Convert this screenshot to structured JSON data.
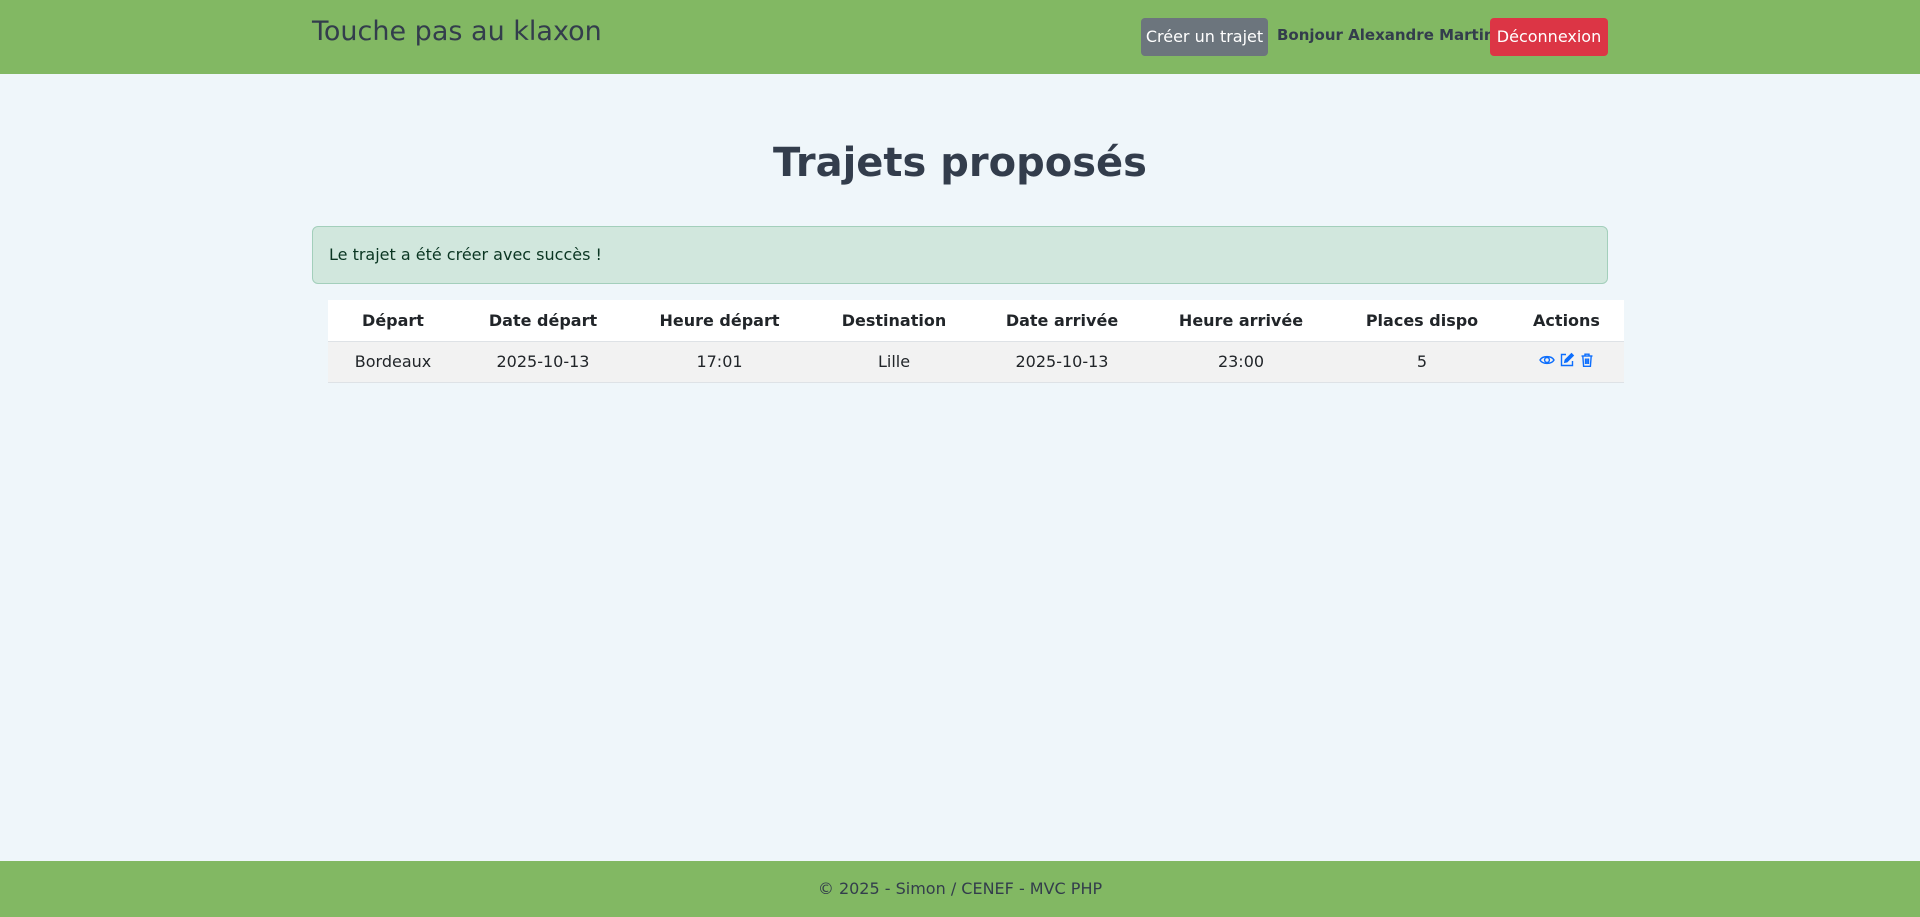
{
  "navbar": {
    "brand": "Touche pas au klaxon",
    "create_label": "Créer un trajet",
    "greeting": "Bonjour Alexandre Martin",
    "logout_label": "Déconnexion"
  },
  "main": {
    "title": "Trajets proposés",
    "alert": "Le trajet a été créer avec succès !"
  },
  "table": {
    "headers": [
      "Départ",
      "Date départ",
      "Heure départ",
      "Destination",
      "Date arrivée",
      "Heure arrivée",
      "Places dispo",
      "Actions"
    ],
    "rows": [
      {
        "depart": "Bordeaux",
        "date_depart": "2025-10-13",
        "heure_depart": "17:01",
        "destination": "Lille",
        "date_arrivee": "2025-10-13",
        "heure_arrivee": "23:00",
        "places": "5",
        "actions": [
          "eye-icon",
          "edit-icon",
          "trash-icon"
        ]
      }
    ]
  },
  "footer": {
    "text": "© 2025 - Simon / CENEF - MVC PHP"
  },
  "colors": {
    "navbar": "#82b863",
    "background": "#eff6fa",
    "create_button": "#6c757d",
    "logout_button": "#dc3545",
    "alert_bg": "#d1e7dd",
    "action_icon": "#0d6efd"
  }
}
